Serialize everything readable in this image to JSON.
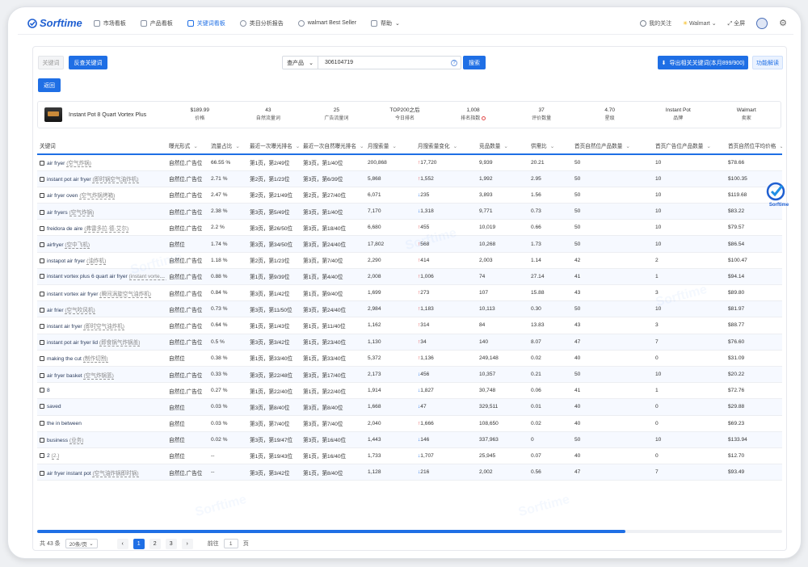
{
  "brand": {
    "name": "Sorftime"
  },
  "nav": {
    "items": [
      {
        "label": "市场看板",
        "active": false
      },
      {
        "label": "产品看板",
        "active": false
      },
      {
        "label": "关键词看板",
        "active": true
      },
      {
        "label": "类目分析报告",
        "active": false
      },
      {
        "label": "walmart Best Seller",
        "active": false
      },
      {
        "label": "帮助",
        "active": false
      }
    ],
    "favorites": "我的关注",
    "marketplace": "Walmart",
    "fullscreen": "全屏"
  },
  "toolbar": {
    "tab_keyword": "关键词",
    "tab_reverse": "反查关键词",
    "back": "返回",
    "search_type": "查产品",
    "search_value": "306104719",
    "search_button": "搜索",
    "export_button": "导出相关关键词(本月899/900)",
    "feature_button": "功能解读"
  },
  "product": {
    "name": "Instant Pot 8 Quart Vortex Plus",
    "stats": [
      {
        "value": "$189.99",
        "label": "价格"
      },
      {
        "value": "43",
        "label": "自然流量词"
      },
      {
        "value": "25",
        "label": "广告流量词"
      },
      {
        "value": "TOP200之后",
        "label": "今日排名"
      },
      {
        "value": "1,008",
        "label": "排名指数"
      },
      {
        "value": "37",
        "label": "评价数量"
      },
      {
        "value": "4.70",
        "label": "星级"
      },
      {
        "value": "Instant Pot",
        "label": "品牌"
      },
      {
        "value": "Walmart",
        "label": "卖家"
      }
    ]
  },
  "table": {
    "headers": [
      "关键词",
      "曝光形式",
      "流量占比",
      "最近一次曝光排名",
      "最近一次自然曝光排名",
      "月搜索量",
      "月搜索量变化",
      "竞品数量",
      "供需比",
      "首页自然位产品数量",
      "首页广告位产品数量",
      "首页自然位平均价格"
    ],
    "rows": [
      {
        "kw": "air fryer",
        "tr": "(空气炸锅)",
        "form": "自然位,广告位",
        "share": "66.55 %",
        "last": "第1页，第2/49位",
        "lastnat": "第3页，第1/40位",
        "vol": "200,868",
        "dir": "up",
        "chg": "17,720",
        "comp": "9,939",
        "ratio": "20.21",
        "nat": "50",
        "ad": "10",
        "price": "$78.66"
      },
      {
        "kw": "instant pot air fryer",
        "tr": "(即时锅空气油炸机)",
        "form": "自然位,广告位",
        "share": "2.71 %",
        "last": "第2页，第1/23位",
        "lastnat": "第3页，第6/39位",
        "vol": "5,868",
        "dir": "up",
        "chg": "1,552",
        "comp": "1,992",
        "ratio": "2.95",
        "nat": "50",
        "ad": "10",
        "price": "$100.35"
      },
      {
        "kw": "air fryer oven",
        "tr": "(空气炸锅烤箱)",
        "form": "自然位,广告位",
        "share": "2.47 %",
        "last": "第2页，第21/49位",
        "lastnat": "第2页，第27/40位",
        "vol": "6,071",
        "dir": "down",
        "chg": "235",
        "comp": "3,893",
        "ratio": "1.56",
        "nat": "50",
        "ad": "10",
        "price": "$119.68"
      },
      {
        "kw": "air fryers",
        "tr": "(空气炸锅)",
        "form": "自然位,广告位",
        "share": "2.38 %",
        "last": "第3页，第5/49位",
        "lastnat": "第3页，第1/40位",
        "vol": "7,170",
        "dir": "down",
        "chg": "1,318",
        "comp": "9,771",
        "ratio": "0.73",
        "nat": "50",
        "ad": "10",
        "price": "$83.22"
      },
      {
        "kw": "freidora de aire",
        "tr": "(弗雷多拉·德·艾尔)",
        "form": "自然位,广告位",
        "share": "2.2 %",
        "last": "第3页，第26/50位",
        "lastnat": "第3页，第18/40位",
        "vol": "6,680",
        "dir": "up",
        "chg": "455",
        "comp": "10,019",
        "ratio": "0.66",
        "nat": "50",
        "ad": "10",
        "price": "$79.57"
      },
      {
        "kw": "airfryer",
        "tr": "(空中飞机)",
        "form": "自然位",
        "share": "1.74 %",
        "last": "第3页，第34/50位",
        "lastnat": "第3页，第24/40位",
        "vol": "17,802",
        "dir": "up",
        "chg": "568",
        "comp": "10,268",
        "ratio": "1.73",
        "nat": "50",
        "ad": "10",
        "price": "$86.54"
      },
      {
        "kw": "instapot air fryer",
        "tr": "(油炸机)",
        "form": "自然位,广告位",
        "share": "1.18 %",
        "last": "第2页，第1/23位",
        "lastnat": "第3页，第7/40位",
        "vol": "2,290",
        "dir": "up",
        "chg": "414",
        "comp": "2,003",
        "ratio": "1.14",
        "nat": "42",
        "ad": "2",
        "price": "$100.47"
      },
      {
        "kw": "instant vortex plus 6 quart air fryer",
        "tr": "(instant vortex plus 6 quart air fryer)",
        "form": "自然位,广告位",
        "share": "0.88 %",
        "last": "第1页，第9/39位",
        "lastnat": "第1页，第4/40位",
        "vol": "2,008",
        "dir": "up",
        "chg": "1,006",
        "comp": "74",
        "ratio": "27.14",
        "nat": "41",
        "ad": "1",
        "price": "$94.14"
      },
      {
        "kw": "instant vortex air fryer",
        "tr": "(瞬间涡旋空气油炸机)",
        "form": "自然位,广告位",
        "share": "0.84 %",
        "last": "第3页，第1/42位",
        "lastnat": "第1页，第9/40位",
        "vol": "1,699",
        "dir": "up",
        "chg": "273",
        "comp": "107",
        "ratio": "15.88",
        "nat": "43",
        "ad": "3",
        "price": "$89.80"
      },
      {
        "kw": "air frier",
        "tr": "(空气吹风机)",
        "form": "自然位,广告位",
        "share": "0.73 %",
        "last": "第3页，第11/50位",
        "lastnat": "第3页，第24/40位",
        "vol": "2,984",
        "dir": "up",
        "chg": "1,183",
        "comp": "10,113",
        "ratio": "0.30",
        "nat": "50",
        "ad": "10",
        "price": "$81.97"
      },
      {
        "kw": "instant air fryer",
        "tr": "(即时空气油炸机)",
        "form": "自然位,广告位",
        "share": "0.64 %",
        "last": "第1页，第1/43位",
        "lastnat": "第1页，第11/40位",
        "vol": "1,162",
        "dir": "up",
        "chg": "314",
        "comp": "84",
        "ratio": "13.83",
        "nat": "43",
        "ad": "3",
        "price": "$88.77"
      },
      {
        "kw": "instant pot air fryer lid",
        "tr": "(即食锅气炸锅盖)",
        "form": "自然位,广告位",
        "share": "0.5 %",
        "last": "第3页，第3/42位",
        "lastnat": "第1页，第23/40位",
        "vol": "1,130",
        "dir": "up",
        "chg": "34",
        "comp": "140",
        "ratio": "8.07",
        "nat": "47",
        "ad": "7",
        "price": "$76.60"
      },
      {
        "kw": "making the cut",
        "tr": "(制作切割)",
        "form": "自然位",
        "share": "0.38 %",
        "last": "第1页，第33/40位",
        "lastnat": "第1页，第33/40位",
        "vol": "5,372",
        "dir": "up",
        "chg": "1,136",
        "comp": "249,148",
        "ratio": "0.02",
        "nat": "40",
        "ad": "0",
        "price": "$31.09"
      },
      {
        "kw": "air fryer basket",
        "tr": "(空气炸锅篮)",
        "form": "自然位,广告位",
        "share": "0.33 %",
        "last": "第3页，第22/48位",
        "lastnat": "第3页，第17/40位",
        "vol": "2,173",
        "dir": "down",
        "chg": "456",
        "comp": "10,357",
        "ratio": "0.21",
        "nat": "50",
        "ad": "10",
        "price": "$20.22"
      },
      {
        "kw": "8",
        "tr": "",
        "form": "自然位,广告位",
        "share": "0.27 %",
        "last": "第1页，第22/40位",
        "lastnat": "第1页，第22/40位",
        "vol": "1,914",
        "dir": "down",
        "chg": "1,827",
        "comp": "30,748",
        "ratio": "0.06",
        "nat": "41",
        "ad": "1",
        "price": "$72.76"
      },
      {
        "kw": "saved",
        "tr": "",
        "form": "自然位",
        "share": "0.03 %",
        "last": "第3页，第8/40位",
        "lastnat": "第3页，第8/40位",
        "vol": "1,668",
        "dir": "down",
        "chg": "47",
        "comp": "329,511",
        "ratio": "0.01",
        "nat": "40",
        "ad": "0",
        "price": "$29.88"
      },
      {
        "kw": "the in between",
        "tr": "",
        "form": "自然位",
        "share": "0.03 %",
        "last": "第3页，第7/40位",
        "lastnat": "第3页，第7/40位",
        "vol": "2,040",
        "dir": "up",
        "chg": "1,666",
        "comp": "108,650",
        "ratio": "0.02",
        "nat": "40",
        "ad": "0",
        "price": "$69.23"
      },
      {
        "kw": "business",
        "tr": "(业务)",
        "form": "自然位",
        "share": "0.02 %",
        "last": "第3页，第19/47位",
        "lastnat": "第3页，第16/40位",
        "vol": "1,443",
        "dir": "down",
        "chg": "146",
        "comp": "337,963",
        "ratio": "0",
        "nat": "50",
        "ad": "10",
        "price": "$133.94"
      },
      {
        "kw": "2",
        "tr": "(2.)",
        "form": "自然位",
        "share": "--",
        "last": "第1页，第19/43位",
        "lastnat": "第1页，第16/40位",
        "vol": "1,733",
        "dir": "down",
        "chg": "1,707",
        "comp": "25,945",
        "ratio": "0.07",
        "nat": "40",
        "ad": "0",
        "price": "$12.70"
      },
      {
        "kw": "air fryer instant pot",
        "tr": "(空气油炸锅即时锅)",
        "form": "自然位,广告位",
        "share": "--",
        "last": "第3页，第3/42位",
        "lastnat": "第1页，第8/40位",
        "vol": "1,128",
        "dir": "down",
        "chg": "216",
        "comp": "2,002",
        "ratio": "0.56",
        "nat": "47",
        "ad": "7",
        "price": "$93.49"
      }
    ]
  },
  "pagination": {
    "total": "共 43 条",
    "page_size": "20条/页",
    "pages": [
      "1",
      "2",
      "3"
    ],
    "current": "1",
    "goto_label": "前往",
    "goto_value": "1",
    "page_suffix": "页"
  },
  "watermark": "Sorftime",
  "colors": {
    "accent": "#1f6fe5",
    "up": "#e03c3c",
    "down": "#1f6fe5"
  }
}
